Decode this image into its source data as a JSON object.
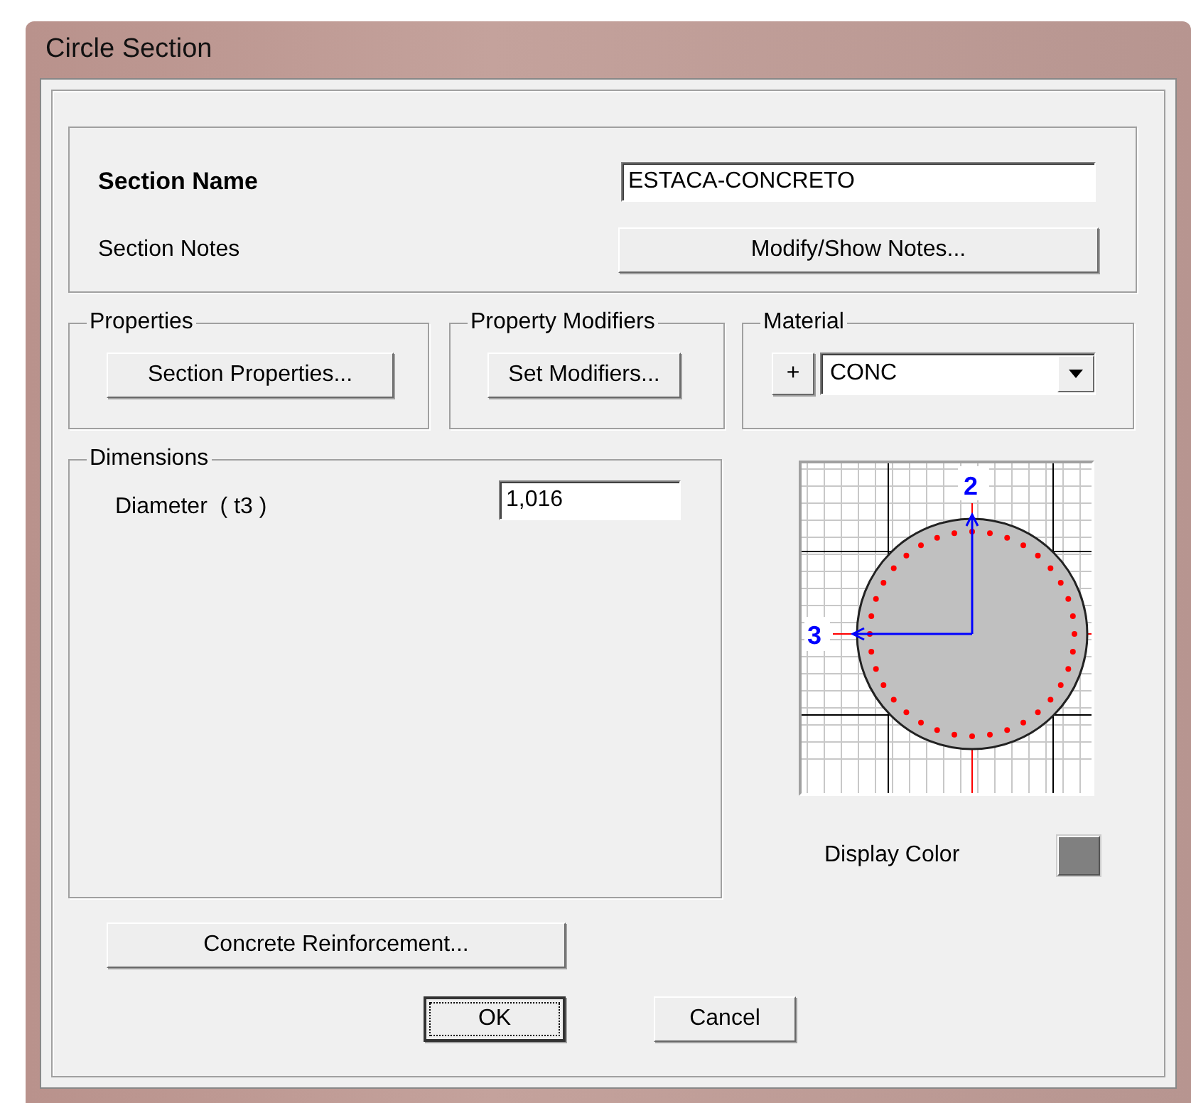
{
  "window": {
    "title": "Circle Section"
  },
  "section": {
    "name_label": "Section Name",
    "name_value": "ESTACA-CONCRETO",
    "notes_label": "Section Notes",
    "notes_button": "Modify/Show Notes..."
  },
  "properties": {
    "title": "Properties",
    "button": "Section Properties..."
  },
  "property_modifiers": {
    "title": "Property Modifiers",
    "button": "Set Modifiers..."
  },
  "material": {
    "title": "Material",
    "add_button": "+",
    "value": "CONC"
  },
  "dimensions": {
    "title": "Dimensions",
    "fields": [
      {
        "label": "Diameter  ( t3 )",
        "value": "1,016"
      }
    ]
  },
  "preview": {
    "axis_labels": [
      "2",
      "3"
    ]
  },
  "display_color": {
    "label": "Display Color",
    "color": "#808080"
  },
  "reinforcement_button": "Concrete Reinforcement...",
  "buttons": [
    {
      "label": "OK",
      "focused": true
    },
    {
      "label": "Cancel",
      "focused": false
    }
  ]
}
